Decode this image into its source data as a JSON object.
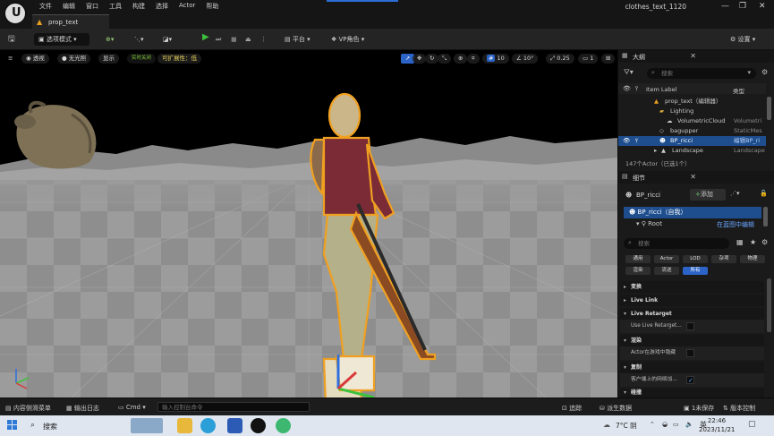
{
  "menu": [
    "文件",
    "编辑",
    "窗口",
    "工具",
    "构建",
    "选择",
    "Actor",
    "帮助"
  ],
  "project_name": "clothes_text_1120",
  "tab": {
    "label": "prop_text"
  },
  "toolbar": {
    "save_label": "",
    "mode": "选项模式",
    "platform": "平台",
    "vp_role": "VP角色",
    "settings": "设置"
  },
  "viewport_toolbar": {
    "perspective": "透视",
    "lit": "无光照",
    "show": "显示",
    "realtime_off": "实时关闭",
    "scalability": "可扩展性：低",
    "grid_snap": "10",
    "rot_snap": "10°",
    "scale_snap": "0.25",
    "cam_speed": "1"
  },
  "outliner": {
    "title": "大纲",
    "search_placeholder": "搜索",
    "col_label": "Item Label",
    "col_type": "类型",
    "rows": [
      {
        "name": "prop_text（编辑器）",
        "type": ""
      },
      {
        "name": "Lighting",
        "type": ""
      },
      {
        "name": "VolumetricCloud",
        "type": "Volumetri"
      },
      {
        "name": "bagupper",
        "type": "StaticMes"
      },
      {
        "name": "BP_ricci",
        "type": "编辑BP_ri"
      },
      {
        "name": "Landscape",
        "type": "Landscape"
      }
    ],
    "status": "147个Actor（已选1个）"
  },
  "details": {
    "title": "细节",
    "actor_name": "BP_ricci",
    "add_label": "添加",
    "self_label": "BP_ricci（自我）",
    "root_label": "Root",
    "edit_in_bp": "在蓝图中编辑",
    "search_placeholder": "搜索",
    "filters_row1": [
      "通用",
      "Actor",
      "LOD",
      "杂项",
      "物理"
    ],
    "filters_row2": [
      "渲染",
      "流送",
      "所有"
    ],
    "sections": {
      "transform": "变换",
      "live_link": "Live Link",
      "live_retarget": "Live Retarget",
      "use_live_retarget": "Use Live Retarget...",
      "rendering": "渲染",
      "actor_hidden": "Actor在游戏中隐藏",
      "replication": "复制",
      "client_net": "客户端上的网络加...",
      "collision": "碰撞"
    }
  },
  "statusbar": {
    "content_drawer": "内容侧滑菜单",
    "output_log": "输出日志",
    "cmd": "Cmd",
    "cmd_placeholder": "输入控制台命令",
    "trace": "追踪",
    "derived_data": "派生数据",
    "unsaved": "1未保存",
    "revision": "版本控制"
  },
  "taskbar": {
    "search_label": "搜索",
    "weather": "7°C 阴",
    "ime": "英",
    "time": "22:46",
    "date": "2023/11/21"
  },
  "colors": {
    "accent": "#2b63c7",
    "selection": "#1e4e8e",
    "outline": "#f0a020",
    "play": "#3cbd3c"
  }
}
